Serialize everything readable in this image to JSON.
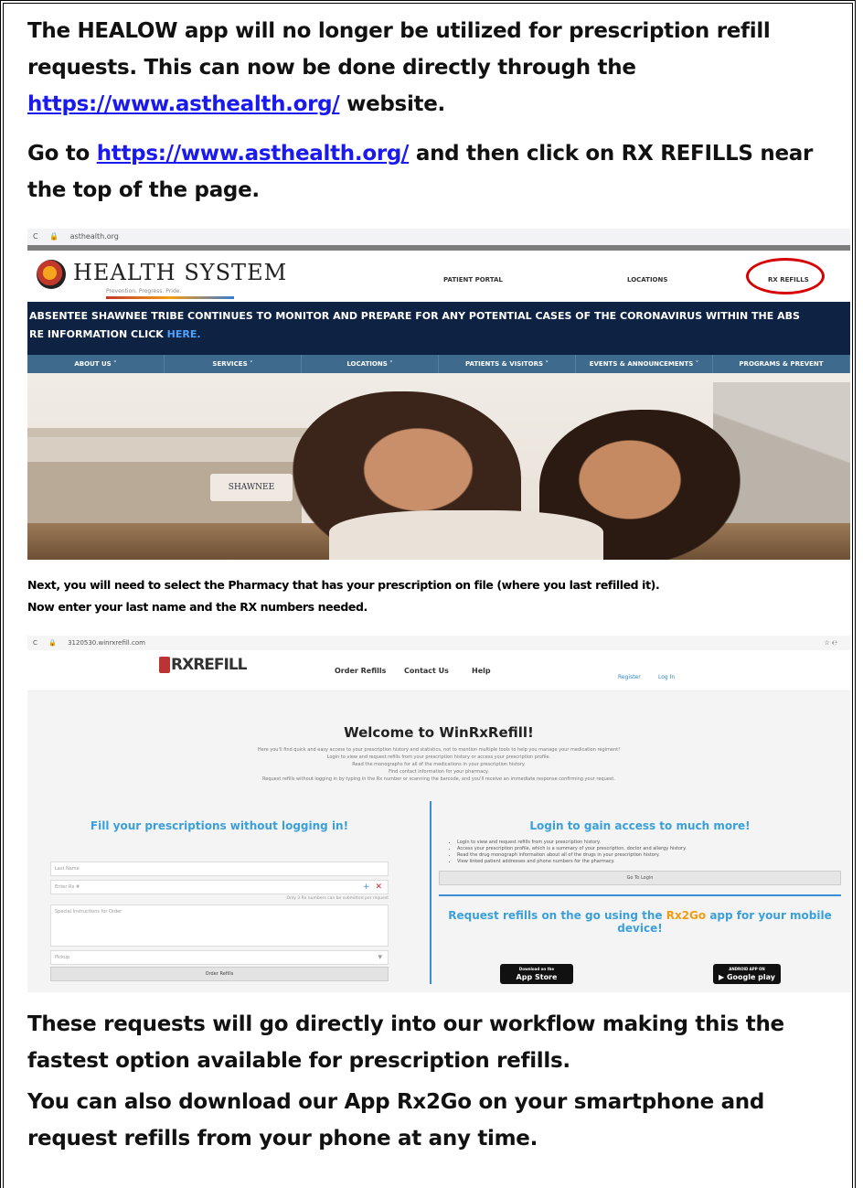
{
  "intro": {
    "line1": "The HEALOW app will no longer be utilized for prescription refill",
    "line2": "requests.  This can now be done directly through the",
    "link1": "https://www.asthealth.org/",
    "line3_tail": " website."
  },
  "go_to": {
    "prefix": "Go to ",
    "link": "https://www.asthealth.org/",
    "suffix": " and then click on RX REFILLS near the top of the page."
  },
  "browser1": {
    "url": "asthealth.org",
    "nav_back": "C",
    "logo_title": "HEALTH SYSTEM",
    "logo_sub": "Prevention. Progress. Pride.",
    "nav": [
      "PATIENT PORTAL",
      "LOCATIONS",
      "RX REFILLS"
    ],
    "banner_line1": "ABSENTEE SHAWNEE TRIBE CONTINUES TO MONITOR AND PREPARE FOR ANY POTENTIAL CASES OF THE CORONAVIRUS WITHIN THE ABS",
    "banner_line2_prefix": "RE INFORMATION CLICK ",
    "banner_here": "HERE.",
    "menu": [
      "ABOUT US ˅",
      "SERVICES ˅",
      "LOCATIONS ˅",
      "PATIENTS & VISITORS ˅",
      "EVENTS & ANNOUNCEMENTS ˅",
      "PROGRAMS & PREVENT"
    ],
    "sign": "SHAWNEE"
  },
  "instructions": {
    "line1": "Next, you will need to select the Pharmacy that has your prescription on file (where you last refilled it).",
    "line2": "Now enter your last name and the RX numbers needed."
  },
  "browser2": {
    "url": "3120530.winrxrefill.com",
    "url_right": "☆  ℮",
    "logo_text": "RXREFILL",
    "nav": [
      "Order Refills",
      "Contact Us",
      "Help"
    ],
    "nav_right": [
      "Register",
      "Log In"
    ],
    "welcome_title": "Welcome to WinRxRefill!",
    "welcome_lines": [
      "Here you'll find quick and easy access to your prescription history and statistics, not to mention multiple tools to help you manage your medication regiment!",
      "Login to view and request refills from your prescription history or access your prescription profile.",
      "Read the monographs for all of the medications in your prescription history.",
      "Find contact information for your pharmacy.",
      "Request refills without logging in by typing in the Rx number or scanning the barcode, and you'll receive an immediate response confirming your request."
    ],
    "left_title": "Fill your prescriptions without logging in!",
    "last_name_placeholder": "Last Name",
    "rx_placeholder": "Enter Rx #",
    "rx_hint": "Only 3 Rx numbers can be submitted per request",
    "special_instructions": "Special Instructions for Order",
    "pickup": "Pickup",
    "order_button": "Order Refills",
    "right_title": "Login to gain access to much more!",
    "bullets": [
      "Login to view and request refills from your prescription history.",
      "Access your prescription profile, which is a summary of your prescription, doctor and allergy history.",
      "Read the drug monograph information about all of the drugs in your prescription history.",
      "View linked patient addresses and phone numbers for the pharmacy."
    ],
    "login_button": "Go To Login",
    "go_prefix": "Request refills on the go using the ",
    "go_app": "Rx2Go",
    "go_suffix": " app for your mobile device!",
    "appstore_small": "Download on the",
    "appstore_big": "App Store",
    "googleplay_small": "ANDROID APP ON",
    "googleplay_big": "Google play"
  },
  "outro1": {
    "text": "These requests will go directly into our workflow making this the fastest option available for prescription refills."
  },
  "outro2": {
    "prefix": "You can also download our App ",
    "app": "Rx2Go",
    "suffix": " on your smartphone and request refills from your phone at any time."
  }
}
